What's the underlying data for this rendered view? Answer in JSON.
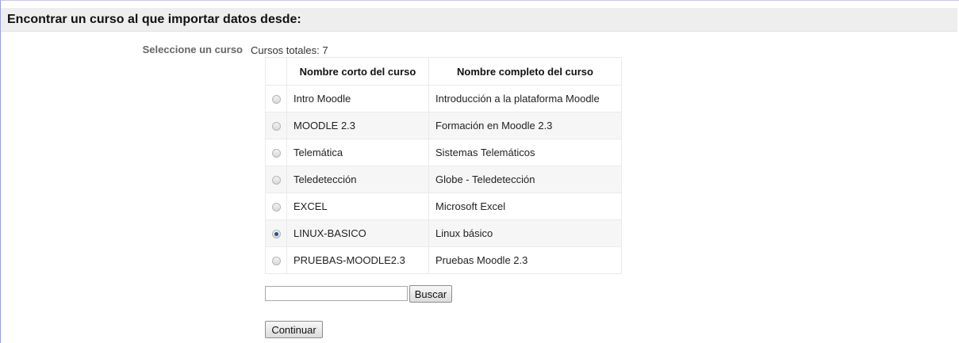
{
  "header": {
    "title": "Encontrar un curso al que importar datos desde:"
  },
  "form": {
    "field_label": "Seleccione un curso",
    "totals_text": "Cursos totales: 7"
  },
  "table": {
    "columns": [
      "",
      "Nombre corto del curso",
      "Nombre completo del curso"
    ],
    "rows": [
      {
        "short": "Intro Moodle",
        "full": "Introducción a la plataforma Moodle",
        "selected": false
      },
      {
        "short": "MOODLE 2.3",
        "full": "Formación en Moodle 2.3",
        "selected": false
      },
      {
        "short": "Telemática",
        "full": "Sistemas Telemáticos",
        "selected": false
      },
      {
        "short": "Teledetección",
        "full": "Globe - Teledetección",
        "selected": false
      },
      {
        "short": "EXCEL",
        "full": "Microsoft Excel",
        "selected": false
      },
      {
        "short": "LINUX-BASICO",
        "full": "Linux básico",
        "selected": true
      },
      {
        "short": "PRUEBAS-MOODLE2.3",
        "full": "Pruebas Moodle 2.3",
        "selected": false
      }
    ]
  },
  "search": {
    "value": "",
    "button_label": "Buscar"
  },
  "actions": {
    "continue_label": "Continuar"
  }
}
